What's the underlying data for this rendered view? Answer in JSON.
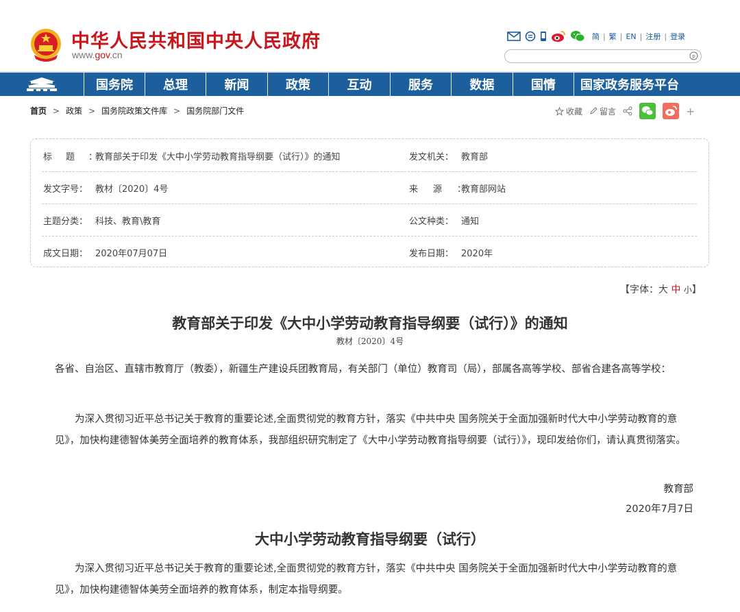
{
  "header": {
    "site_title": "中华人民共和国中央人民政府",
    "url_prefix": "www.",
    "url_domain": "gov",
    "url_suffix": ".cn",
    "top_links": [
      "简",
      "繁",
      "EN",
      "注册",
      "登录"
    ],
    "icons": [
      "mail-icon",
      "chat-icon",
      "mobile-icon",
      "weibo-icon",
      "wechat-icon"
    ],
    "search_placeholder": ""
  },
  "nav": {
    "items": [
      "国务院",
      "总理",
      "新闻",
      "政策",
      "互动",
      "服务",
      "数据",
      "国情",
      "国家政务服务平台"
    ]
  },
  "breadcrumb": {
    "items": [
      "首页",
      "政策",
      "国务院政策文件库",
      "国务院部门文件"
    ],
    "separator": ">"
  },
  "tools": {
    "favorite": "收藏",
    "comment": "留言",
    "more": "+"
  },
  "info": {
    "title_label": "标题：",
    "title_value": "教育部关于印发《大中小学劳动教育指导纲要（试行）》的通知",
    "issuer_label": "发文机关：",
    "issuer_value": "教育部",
    "docno_label": "发文字号：",
    "docno_value": "教材〔2020〕4号",
    "source_label": "来源：",
    "source_value": "教育部网站",
    "topic_label": "主题分类：",
    "topic_value": "科技、教育\\教育",
    "type_label": "公文种类：",
    "type_value": "通知",
    "date_label": "成文日期：",
    "date_value": "2020年07月07日",
    "pubdate_label": "发布日期：",
    "pubdate_value": "2020年"
  },
  "font_size": {
    "open": "【字体：",
    "large": "大",
    "medium": "中",
    "small": "小",
    "close": "】"
  },
  "document": {
    "title": "教育部关于印发《大中小学劳动教育指导纲要（试行）》的通知",
    "doc_number": "教材〔2020〕4号",
    "salutation": "各省、自治区、直辖市教育厅（教委），新疆生产建设兵团教育局，有关部门（单位）教育司（局），部属各高等学校、部省合建各高等学校：",
    "body": "为深入贯彻习近平总书记关于教育的重要论述,全面贯彻党的教育方针，落实《中共中央 国务院关于全面加强新时代大中小学劳动教育的意见》，加快构建德智体美劳全面培养的教育体系，我部组织研究制定了《大中小学劳动教育指导纲要（试行）》，现印发给你们，请认真贯彻落实。",
    "signer": "教育部",
    "sign_date": "2020年7月7日",
    "subtitle": "大中小学劳动教育指导纲要（试行）",
    "body2": "为深入贯彻习近平总书记关于教育的重要论述,全面贯彻党的教育方针，落实《中共中央 国务院关于全面加强新时代大中小学劳动教育的意见》，加快构建德智体美劳全面培养的教育体系，制定本指导纲要。"
  },
  "colors": {
    "brand_red": "#c8161d",
    "nav_blue": "#1d5f9d",
    "link_blue": "#1a59a0"
  }
}
